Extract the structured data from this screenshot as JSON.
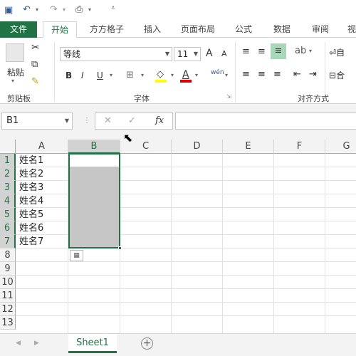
{
  "qat": {
    "save_icon": "save-icon",
    "undo_icon": "undo-icon",
    "redo_icon": "redo-icon",
    "print_icon": "printer-icon",
    "customize_icon": "customize-icon"
  },
  "tabs": {
    "file": "文件",
    "home": "开始",
    "fangfang": "方方格子",
    "insert": "插入",
    "page_layout": "页面布局",
    "formulas": "公式",
    "data": "数据",
    "review": "审阅",
    "view": "视"
  },
  "ribbon": {
    "clipboard": {
      "paste_label": "粘贴",
      "group_label": "剪贴板"
    },
    "font": {
      "font_name": "等线",
      "font_size": "11",
      "grow_label": "A",
      "shrink_label": "A",
      "bold": "B",
      "italic": "I",
      "underline": "U",
      "font_color_label": "A",
      "fill_color_label": "◇",
      "phonetic_label": "wén",
      "group_label": "字体"
    },
    "alignment": {
      "wrap_label": "自",
      "merge_label": "合",
      "group_label": "对齐方式"
    }
  },
  "formula_bar": {
    "name_box": "B1",
    "cancel": "✕",
    "enter": "✓",
    "fx": "fx",
    "value": ""
  },
  "grid": {
    "columns": [
      "A",
      "B",
      "C",
      "D",
      "E",
      "F",
      "G"
    ],
    "rows": [
      "1",
      "2",
      "3",
      "4",
      "5",
      "6",
      "7",
      "8",
      "9",
      "10",
      "11",
      "12",
      "13"
    ],
    "column_a": [
      "姓名1",
      "姓名2",
      "姓名3",
      "姓名4",
      "姓名5",
      "姓名6",
      "姓名7"
    ],
    "selected_column": "B",
    "selected_range": "B1:B7"
  },
  "sheets": {
    "active": "Sheet1",
    "add": "+"
  },
  "colors": {
    "accent": "#217346",
    "selection_fill": "#c6c6c6"
  }
}
